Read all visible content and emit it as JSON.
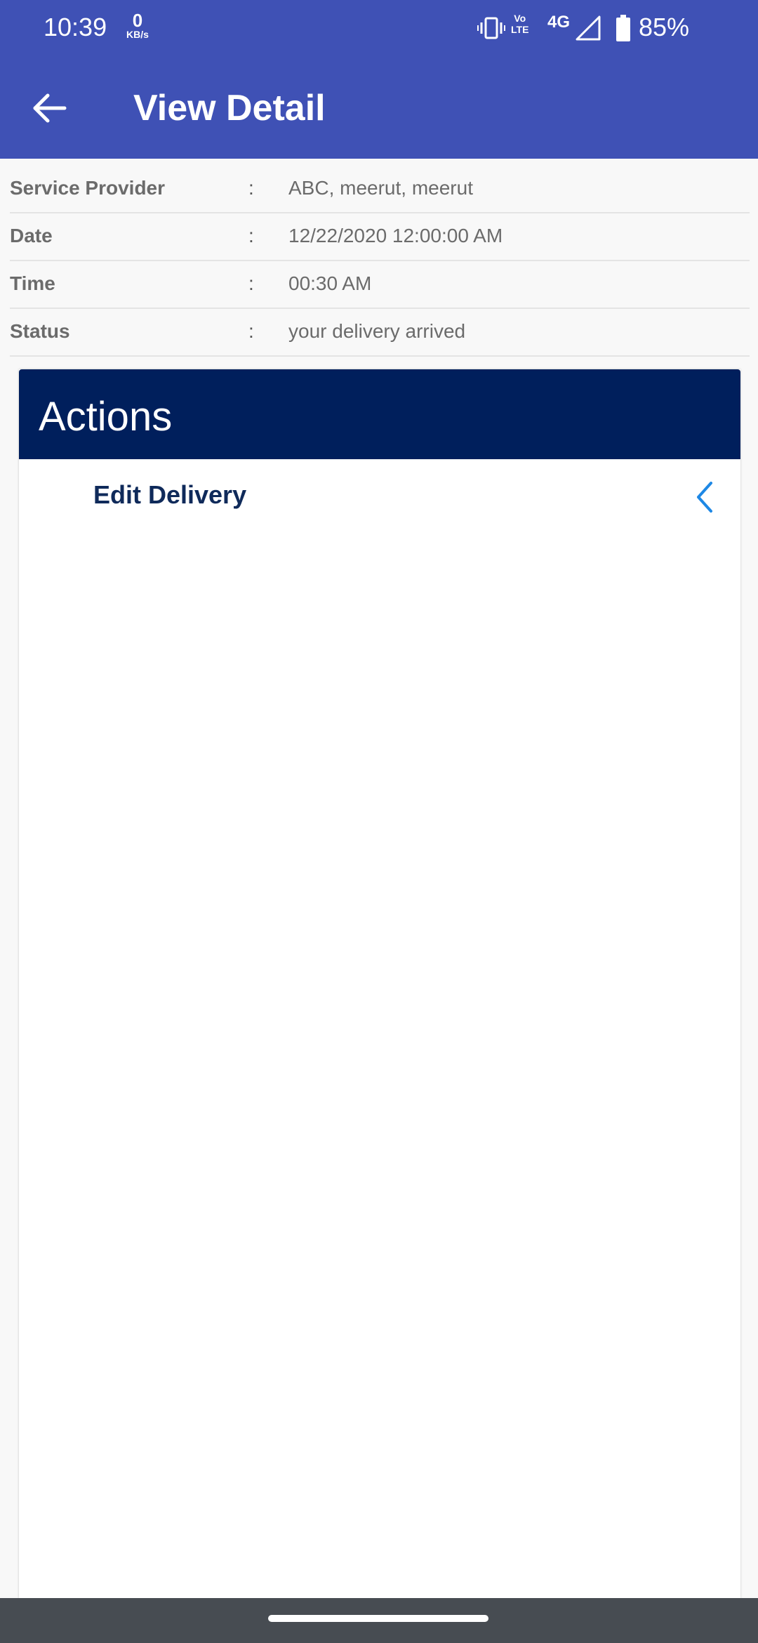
{
  "status_bar": {
    "time": "10:39",
    "net_speed_value": "0",
    "net_speed_unit": "KB/s",
    "volte_top": "Vo",
    "volte_bottom": "LTE",
    "network": "4G",
    "battery_percent": "85%",
    "icons": [
      "vibrate-icon",
      "volte-icon",
      "signal-icon",
      "battery-icon"
    ]
  },
  "app_bar": {
    "title": "View Detail",
    "back_icon": "arrow-left-icon",
    "color": "#3f51b5"
  },
  "details": [
    {
      "label": "Service Provider",
      "separator": ":",
      "value": "ABC, meerut, meerut"
    },
    {
      "label": "Date",
      "separator": ":",
      "value": "12/22/2020 12:00:00 AM"
    },
    {
      "label": "Time",
      "separator": ":",
      "value": "00:30 AM"
    },
    {
      "label": "Status",
      "separator": ":",
      "value": "your delivery arrived"
    }
  ],
  "actions_card": {
    "title": "Actions",
    "header_color": "#001f5c",
    "items": [
      {
        "label": "Edit Delivery",
        "icon": "chevron-left-icon",
        "icon_color": "#1e88e5"
      }
    ]
  }
}
